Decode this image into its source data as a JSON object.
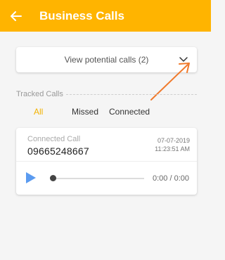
{
  "appbar": {
    "title": "Business Calls",
    "back_icon": "back-arrow-icon"
  },
  "potential": {
    "label": "View potential calls (2)",
    "chevron_icon": "chevron-down-icon"
  },
  "section": {
    "label": "Tracked Calls"
  },
  "tabs": [
    {
      "label": "All",
      "active": true
    },
    {
      "label": "Missed",
      "active": false
    },
    {
      "label": "Connected",
      "active": false
    }
  ],
  "call": {
    "type_label": "Connected Call",
    "number": "09665248667",
    "date": "07-07-2019",
    "time": "11:23:51 AM",
    "duration": "0:00 / 0:00",
    "progress": 0
  },
  "colors": {
    "accent": "#ffb400",
    "play": "#5b9bf0",
    "annotation": "#f07a2c"
  }
}
